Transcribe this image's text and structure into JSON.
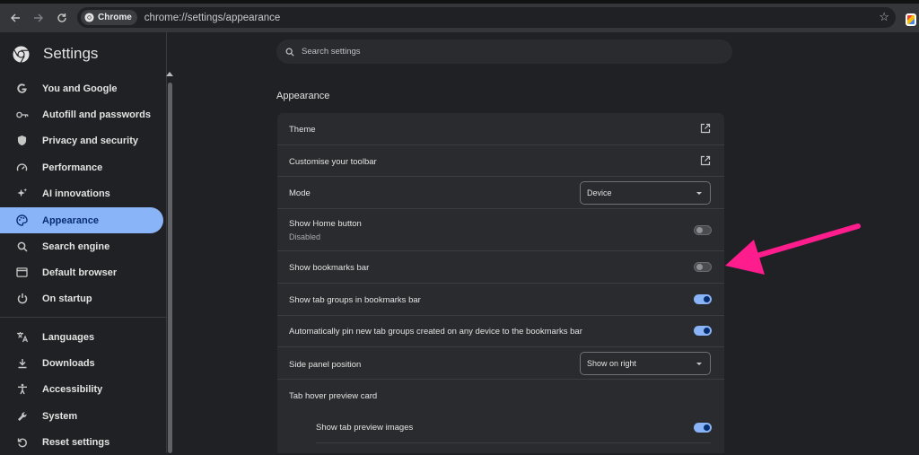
{
  "browser": {
    "chip_label": "Chrome",
    "url": "chrome://settings/appearance"
  },
  "sidebar": {
    "title": "Settings",
    "items": [
      {
        "label": "You and Google",
        "icon": "google-g-icon"
      },
      {
        "label": "Autofill and passwords",
        "icon": "key-icon"
      },
      {
        "label": "Privacy and security",
        "icon": "shield-icon"
      },
      {
        "label": "Performance",
        "icon": "speedometer-icon"
      },
      {
        "label": "AI innovations",
        "icon": "sparkle-icon"
      },
      {
        "label": "Appearance",
        "icon": "palette-icon",
        "active": true
      },
      {
        "label": "Search engine",
        "icon": "search-icon"
      },
      {
        "label": "Default browser",
        "icon": "browser-window-icon"
      },
      {
        "label": "On startup",
        "icon": "power-icon"
      },
      {
        "label": "Languages",
        "icon": "translate-icon"
      },
      {
        "label": "Downloads",
        "icon": "download-icon"
      },
      {
        "label": "Accessibility",
        "icon": "accessibility-icon"
      },
      {
        "label": "System",
        "icon": "wrench-icon"
      },
      {
        "label": "Reset settings",
        "icon": "reset-icon"
      }
    ]
  },
  "search": {
    "placeholder": "Search settings"
  },
  "appearance": {
    "section_title": "Appearance",
    "theme": "Theme",
    "customise_toolbar": "Customise your toolbar",
    "mode_label": "Mode",
    "mode_value": "Device",
    "home_button_label": "Show Home button",
    "home_button_sub": "Disabled",
    "home_button_on": false,
    "bookmarks_bar_label": "Show bookmarks bar",
    "bookmarks_bar_on": false,
    "tab_groups_label": "Show tab groups in bookmarks bar",
    "tab_groups_on": true,
    "auto_pin_label": "Automatically pin new tab groups created on any device to the bookmarks bar",
    "auto_pin_on": true,
    "side_panel_label": "Side panel position",
    "side_panel_value": "Show on right",
    "hover_card_label": "Tab hover preview card",
    "preview_images_label": "Show tab preview images",
    "preview_images_on": true
  },
  "colors": {
    "accent": "#8ab4f8",
    "annotation_arrow": "#ff1c8d"
  }
}
